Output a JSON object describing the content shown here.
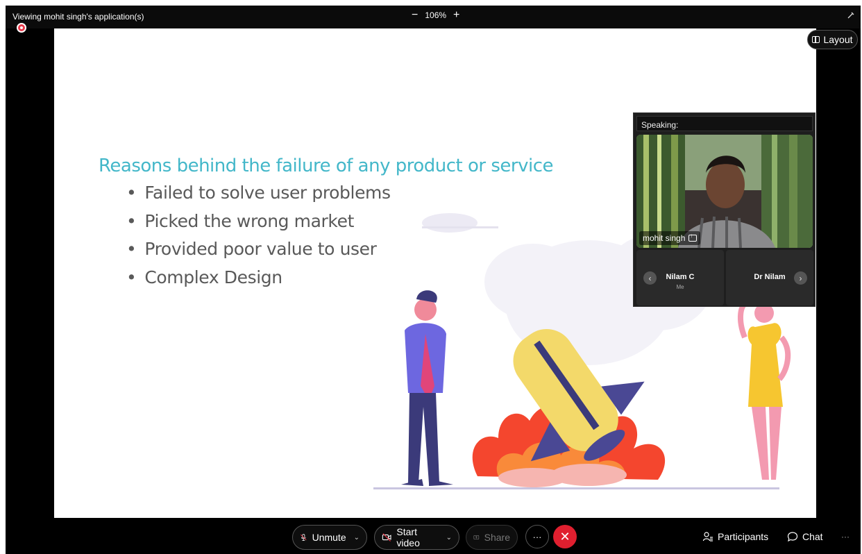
{
  "topbar": {
    "viewing_text": "Viewing mohit singh's application(s)",
    "zoom_minus": "−",
    "zoom_level": "106%",
    "zoom_plus": "+"
  },
  "slide": {
    "title": "Reasons behind the failure of any product or service",
    "bullets": [
      "Failed to solve user problems",
      "Picked the wrong market",
      "Provided poor value to user",
      "Complex Design"
    ]
  },
  "layout_button": {
    "label": "Layout"
  },
  "video_panel": {
    "speaking_label": "Speaking:",
    "active_speaker": "mohit singh",
    "tiles": [
      {
        "name": "Nilam C",
        "sub": "Me"
      },
      {
        "name": "Dr Nilam",
        "sub": ""
      }
    ]
  },
  "controls": {
    "unmute_label": "Unmute",
    "start_video_label": "Start video",
    "share_label": "Share",
    "more_label": "···",
    "end_label": "✕",
    "participants_label": "Participants",
    "chat_label": "Chat",
    "overflow_label": "···"
  },
  "colors": {
    "title_accent": "#43b7c9",
    "end_call": "#e01f2f",
    "recording": "#e8394a"
  }
}
